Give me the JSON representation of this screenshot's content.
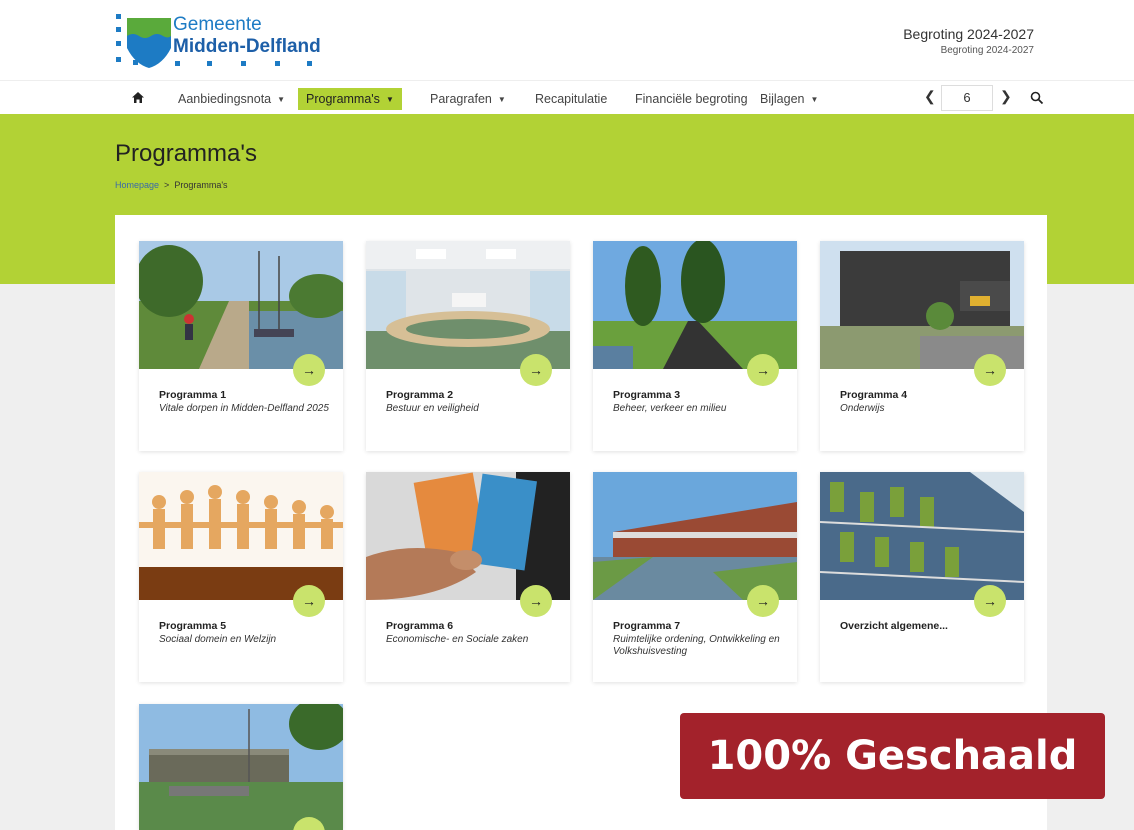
{
  "logo": {
    "line1": "Gemeente",
    "line2": "Midden-Delfland"
  },
  "header": {
    "title": "Begroting 2024-2027",
    "subtitle": "Begroting 2024-2027"
  },
  "nav": {
    "items": [
      {
        "label": "Aanbiedingsnota",
        "has_caret": true,
        "active": false
      },
      {
        "label": "Programma's",
        "has_caret": true,
        "active": true
      },
      {
        "label": "Paragrafen",
        "has_caret": true,
        "active": false
      },
      {
        "label": "Recapitulatie",
        "has_caret": false,
        "active": false
      },
      {
        "label": "Financiële begroting",
        "has_caret": false,
        "active": false
      },
      {
        "label": "Bijlagen",
        "has_caret": true,
        "active": false
      }
    ],
    "page_number": "6",
    "accent": "#b2d235"
  },
  "page": {
    "title": "Programma's",
    "breadcrumb": {
      "home": "Homepage",
      "separator": ">",
      "current": "Programma's"
    }
  },
  "cards": [
    {
      "title": "Programma 1",
      "subtitle": "Vitale dorpen in Midden-Delfland 2025",
      "image": "cycling-path-canal"
    },
    {
      "title": "Programma 2",
      "subtitle": "Bestuur en veiligheid",
      "image": "council-chamber"
    },
    {
      "title": "Programma 3",
      "subtitle": "Beheer, verkeer en milieu",
      "image": "tree-lined-road"
    },
    {
      "title": "Programma 4",
      "subtitle": "Onderwijs",
      "image": "school-building"
    },
    {
      "title": "Programma 5",
      "subtitle": "Sociaal domein en Welzijn",
      "image": "paper-people-chain"
    },
    {
      "title": "Programma 6",
      "subtitle": "Economische- en Sociale zaken",
      "image": "euro-banknotes"
    },
    {
      "title": "Programma 7",
      "subtitle": "Ruimtelijke ordening, Ontwikkeling en Volkshuisvesting",
      "image": "canal-houses"
    },
    {
      "title": "Overzicht algemene...",
      "subtitle": "",
      "image": "office-facade"
    },
    {
      "title": "",
      "subtitle": "",
      "image": "town-hall-water"
    }
  ],
  "badge": {
    "text": "100% Geschaald",
    "color": "#a3222b"
  }
}
